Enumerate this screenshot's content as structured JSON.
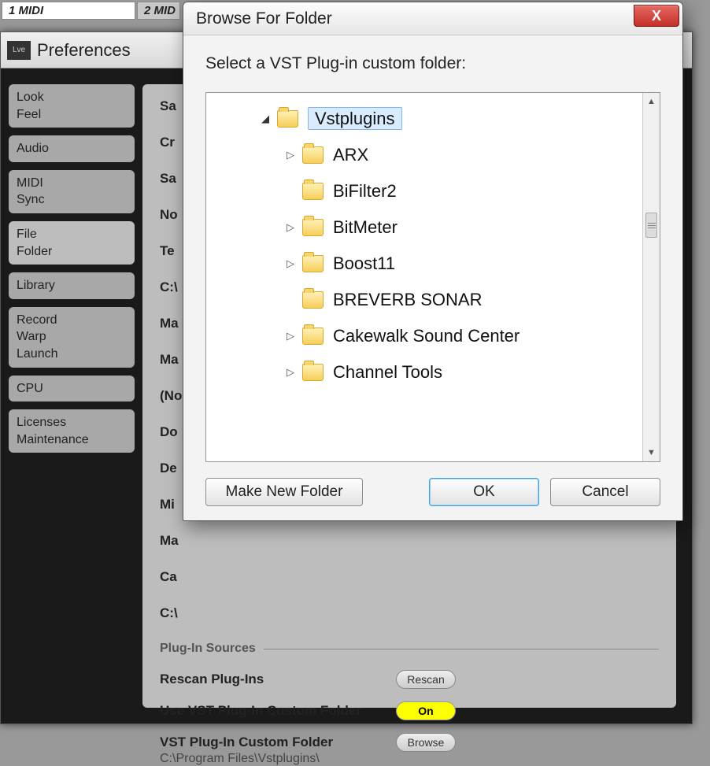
{
  "top_tabs": {
    "first": "1 MIDI",
    "second": "2 MID"
  },
  "prefs": {
    "logo": "Lve",
    "title": "Preferences",
    "sidebar": [
      [
        "Look",
        "Feel"
      ],
      [
        "Audio"
      ],
      [
        "MIDI",
        "Sync"
      ],
      [
        "File",
        "Folder"
      ],
      [
        "Library"
      ],
      [
        "Record",
        "Warp",
        "Launch"
      ],
      [
        "CPU"
      ],
      [
        "Licenses",
        "Maintenance"
      ]
    ],
    "content": {
      "lines": [
        "Sa",
        "Cr",
        "Sa",
        "No",
        "Te",
        "C:\\",
        "Ma",
        "Ma",
        "(No",
        "Do",
        "De",
        "Mi",
        "Ma",
        "Ca",
        "C:\\"
      ],
      "section": "Plug-In Sources",
      "rescan": {
        "label": "Rescan Plug-Ins",
        "btn": "Rescan"
      },
      "useCustom": {
        "label": "Use VST Plug-In Custom Folder",
        "btn": "On"
      },
      "customFolder": {
        "label": "VST Plug-In Custom Folder",
        "btn": "Browse",
        "path": "C:\\Program Files\\Vstplugins\\"
      }
    }
  },
  "dialog": {
    "title": "Browse For Folder",
    "close": "X",
    "label": "Select a VST Plug-in custom folder:",
    "tree": [
      {
        "indent": 60,
        "expander": "▲",
        "selected": true,
        "expandable": true,
        "name": "Vstplugins"
      },
      {
        "indent": 92,
        "expander": "▷",
        "selected": false,
        "expandable": true,
        "name": "ARX"
      },
      {
        "indent": 92,
        "expander": "",
        "selected": false,
        "expandable": false,
        "name": "BiFilter2"
      },
      {
        "indent": 92,
        "expander": "▷",
        "selected": false,
        "expandable": true,
        "name": "BitMeter"
      },
      {
        "indent": 92,
        "expander": "▷",
        "selected": false,
        "expandable": true,
        "name": "Boost11"
      },
      {
        "indent": 92,
        "expander": "",
        "selected": false,
        "expandable": false,
        "name": "BREVERB SONAR"
      },
      {
        "indent": 92,
        "expander": "▷",
        "selected": false,
        "expandable": true,
        "name": "Cakewalk Sound Center"
      },
      {
        "indent": 92,
        "expander": "▷",
        "selected": false,
        "expandable": true,
        "name": "Channel Tools"
      }
    ],
    "buttons": {
      "makeNew": "Make New Folder",
      "ok": "OK",
      "cancel": "Cancel"
    },
    "scroll": {
      "up": "▲",
      "down": "▼"
    }
  }
}
